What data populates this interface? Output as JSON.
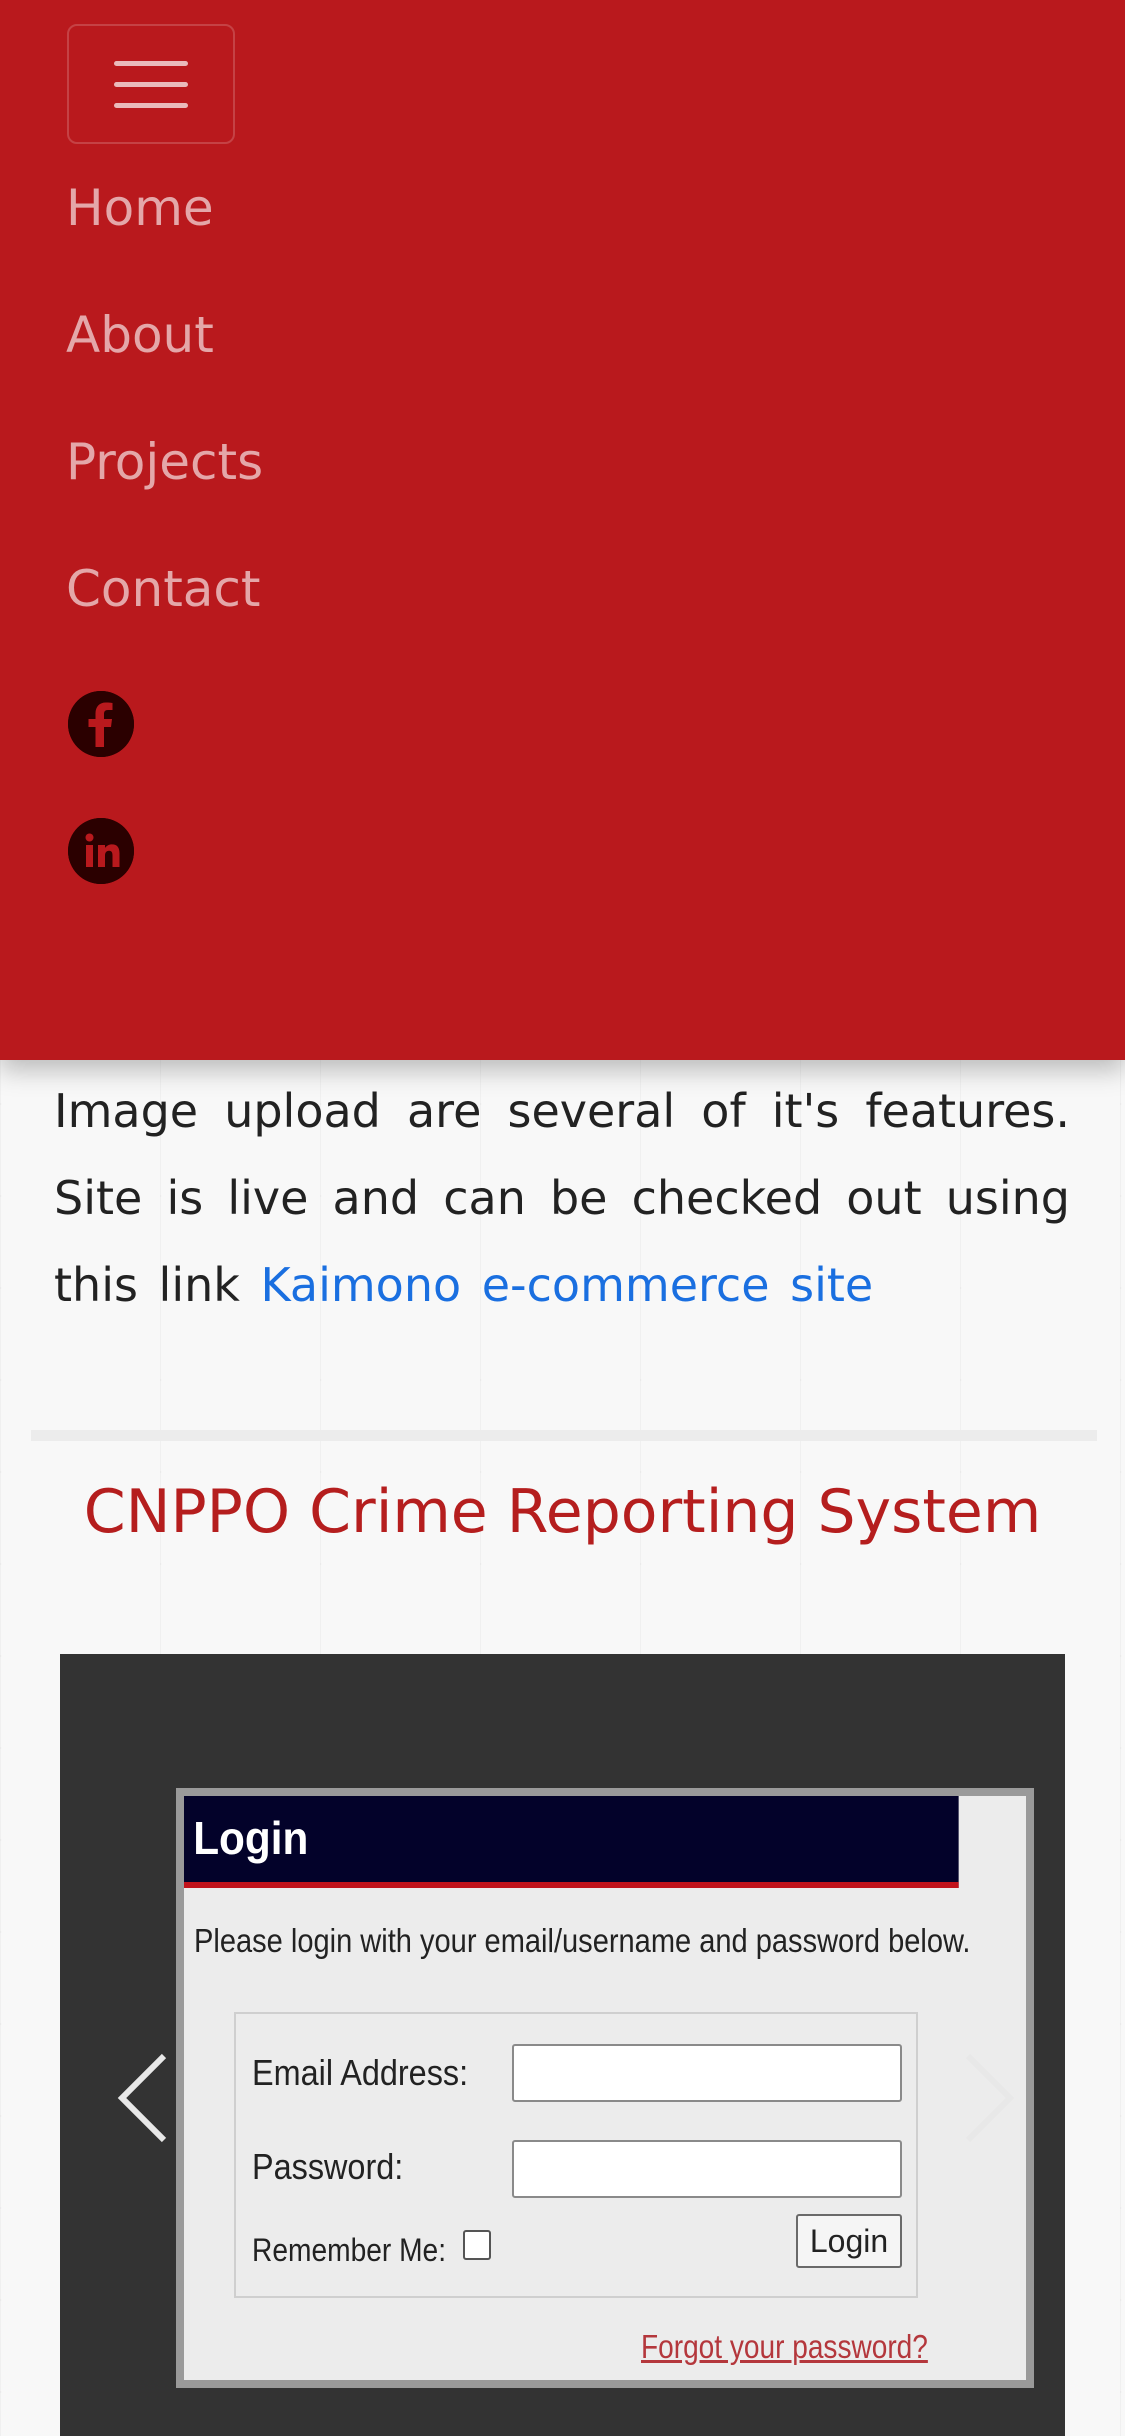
{
  "navbar": {
    "links": [
      {
        "label": "Home"
      },
      {
        "label": "About"
      },
      {
        "label": "Projects"
      },
      {
        "label": "Contact"
      }
    ],
    "social": [
      "facebook-icon",
      "linkedin-icon"
    ],
    "background": "#b9191d"
  },
  "project_intro": {
    "text": "Image upload are several of it's features. Site is live and can be checked out using this link ",
    "link_label": "Kaimono e-commerce site",
    "link_color": "#1a6fe0"
  },
  "section": {
    "title": "CNPPO Crime Reporting System",
    "title_color": "#b51e1e"
  },
  "carousel": {
    "slide": {
      "header": "Login",
      "intro": "Please login with your email/username and password below.",
      "email_label": "Email Address:",
      "password_label": "Password:",
      "remember_label": "Remember Me:",
      "login_button": "Login",
      "forgot_link": "Forgot your password?"
    },
    "prev_icon": "chevron-left-icon",
    "next_icon": "chevron-right-icon"
  }
}
